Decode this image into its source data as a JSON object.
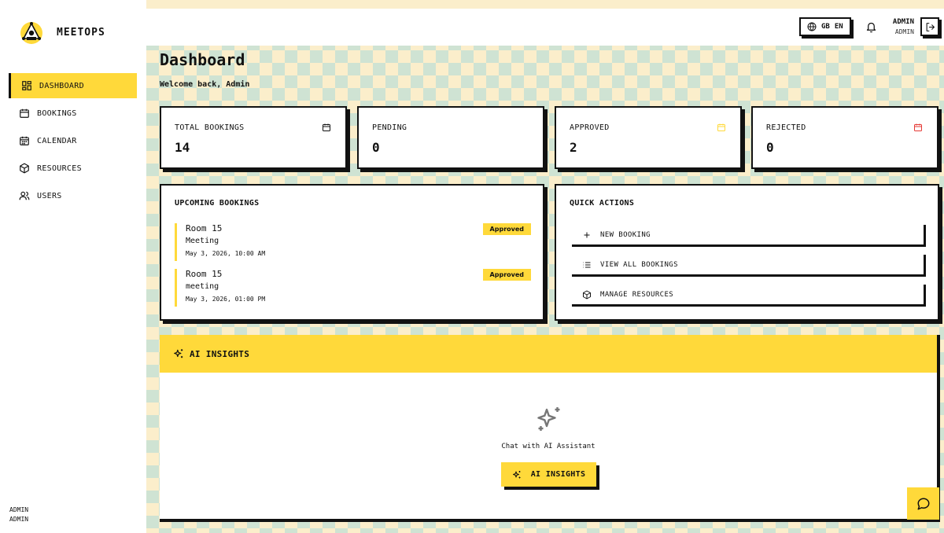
{
  "app": {
    "name": "MEETOPS"
  },
  "sidebar": {
    "items": [
      {
        "label": "DASHBOARD",
        "icon": "dashboard-icon",
        "active": true
      },
      {
        "label": "BOOKINGS",
        "icon": "calendar-icon",
        "active": false
      },
      {
        "label": "CALENDAR",
        "icon": "calendar-grid-icon",
        "active": false
      },
      {
        "label": "RESOURCES",
        "icon": "box-icon",
        "active": false
      },
      {
        "label": "USERS",
        "icon": "users-icon",
        "active": false
      }
    ],
    "user": {
      "name": "ADMIN",
      "role": "ADMIN"
    }
  },
  "header": {
    "lang_flag": "GB",
    "lang_code": "EN",
    "user_name": "ADMIN",
    "user_role": "ADMIN"
  },
  "page": {
    "title": "Dashboard",
    "subtitle": "Welcome back, Admin"
  },
  "stats": [
    {
      "label": "TOTAL BOOKINGS",
      "value": "14",
      "icon_color": "#111111"
    },
    {
      "label": "PENDING",
      "value": "0",
      "icon_color": "#111111"
    },
    {
      "label": "APPROVED",
      "value": "2",
      "icon_color": "#ffd93a"
    },
    {
      "label": "REJECTED",
      "value": "0",
      "icon_color": "#e53935"
    }
  ],
  "upcoming": {
    "title": "UPCOMING BOOKINGS",
    "items": [
      {
        "room": "Room 15",
        "purpose": "Meeting",
        "time": "May 3, 2026, 10:00 AM",
        "status": "Approved"
      },
      {
        "room": "Room 15",
        "purpose": "meeting",
        "time": "May 3, 2026, 01:00 PM",
        "status": "Approved"
      }
    ]
  },
  "quick_actions": {
    "title": "QUICK ACTIONS",
    "items": [
      {
        "label": "NEW BOOKING",
        "icon": "plus-icon"
      },
      {
        "label": "VIEW ALL BOOKINGS",
        "icon": "list-icon"
      },
      {
        "label": "MANAGE RESOURCES",
        "icon": "box-icon"
      }
    ]
  },
  "ai": {
    "title": "AI INSIGHTS",
    "caption": "Chat with AI Assistant",
    "button": "AI INSIGHTS"
  },
  "colors": {
    "accent": "#ffd93a",
    "check_a": "#fbeecb",
    "check_b": "#cfe3d3",
    "danger": "#e53935"
  }
}
